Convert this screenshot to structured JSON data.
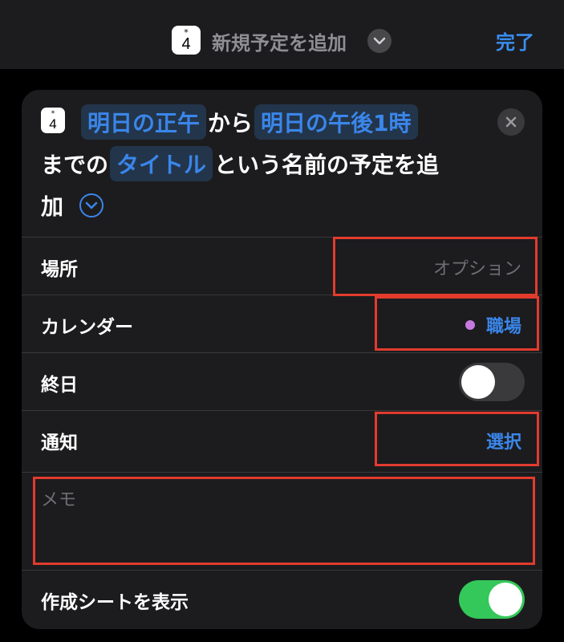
{
  "topbar": {
    "app_icon": {
      "asterisk": "*",
      "number": "4"
    },
    "title": "新規予定を追加",
    "chevron_icon": "chevron-down-icon",
    "done_label": "完了"
  },
  "action": {
    "icon": {
      "asterisk": "*",
      "number": "4"
    },
    "start_token": "明日の正午",
    "from_text": "から",
    "end_token": "明日の午後1時",
    "until_text": "までの",
    "title_token": "タイトル",
    "suffix_text": "という名前の予定を追",
    "suffix_text2": "加"
  },
  "rows": {
    "location": {
      "label": "場所",
      "placeholder": "オプション"
    },
    "calendar": {
      "label": "カレンダー",
      "value": "職場",
      "dot_color": "#c779e0"
    },
    "all_day": {
      "label": "終日",
      "on": false
    },
    "alert": {
      "label": "通知",
      "value": "選択"
    },
    "notes": {
      "placeholder": "メモ"
    },
    "show_compose": {
      "label": "作成シートを表示",
      "on": true
    }
  },
  "colors": {
    "accent": "#3a86ea",
    "toggle_on": "#34c759",
    "highlight": "#e23b2e"
  }
}
